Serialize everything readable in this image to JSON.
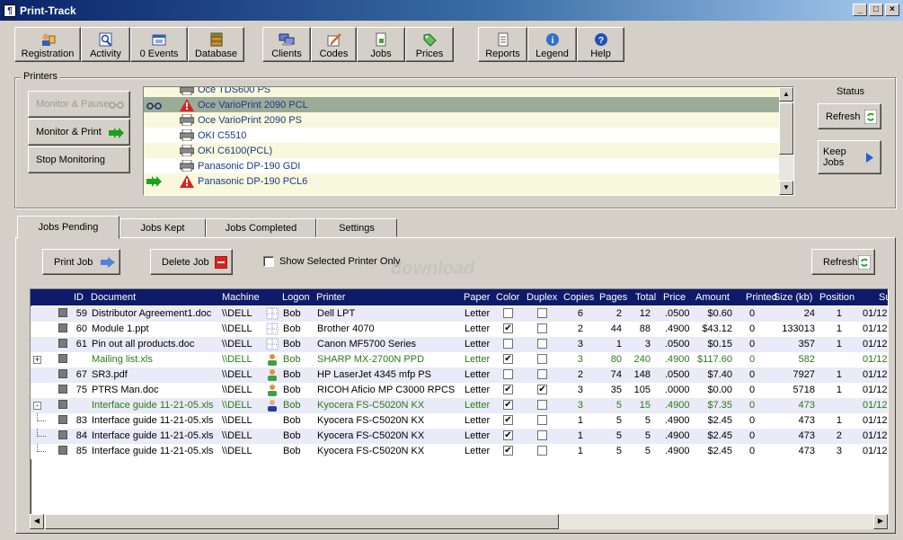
{
  "window": {
    "title": "Print-Track",
    "min": "_",
    "max": "□",
    "close": "×"
  },
  "toolbar": {
    "group1": [
      {
        "label": "Registration",
        "icon": "registration-icon"
      },
      {
        "label": "Activity",
        "icon": "activity-icon"
      },
      {
        "label": "0 Events",
        "icon": "events-icon"
      },
      {
        "label": "Database",
        "icon": "database-icon"
      }
    ],
    "group2": [
      {
        "label": "Clients",
        "icon": "clients-icon"
      },
      {
        "label": "Codes",
        "icon": "codes-icon"
      },
      {
        "label": "Jobs",
        "icon": "jobs-icon"
      },
      {
        "label": "Prices",
        "icon": "prices-icon"
      }
    ],
    "group3": [
      {
        "label": "Reports",
        "icon": "reports-icon"
      },
      {
        "label": "Legend",
        "icon": "legend-icon"
      },
      {
        "label": "Help",
        "icon": "help-icon"
      }
    ]
  },
  "printers_group": {
    "label": "Printers",
    "monitor_pause": "Monitor & Pause",
    "monitor_print": "Monitor & Print",
    "stop_monitoring": "Stop Monitoring",
    "status_label": "Status",
    "refresh": "Refresh",
    "keep_jobs": "Keep Jobs",
    "list": [
      {
        "name": "Oce TDS600 PS",
        "icon": "printer-icon",
        "mark": ""
      },
      {
        "name": "Oce VarioPrint 2090 PCL",
        "icon": "warning-icon",
        "mark": "glasses-icon",
        "selected": true
      },
      {
        "name": "Oce VarioPrint 2090 PS",
        "icon": "printer-icon",
        "mark": ""
      },
      {
        "name": "OKI C5510",
        "icon": "printer-icon",
        "mark": ""
      },
      {
        "name": "OKI C6100(PCL)",
        "icon": "printer-icon",
        "mark": ""
      },
      {
        "name": "Panasonic DP-190 GDI",
        "icon": "printer-icon",
        "mark": ""
      },
      {
        "name": "Panasonic DP-190 PCL6",
        "icon": "warning-icon",
        "mark": "green-arrow-icon"
      }
    ]
  },
  "tabs": [
    "Jobs Pending",
    "Jobs Kept",
    "Jobs Completed",
    "Settings"
  ],
  "jobs": {
    "print_job": "Print Job",
    "delete_job": "Delete Job",
    "show_selected": "Show Selected Printer Only",
    "refresh": "Refresh",
    "watermark": "download",
    "columns": [
      "ID",
      "Document",
      "Machine",
      "Logon",
      "Printer",
      "Paper",
      "Color",
      "Duplex",
      "Copies",
      "Pages",
      "Total",
      "Price",
      "Amount",
      "Printed",
      "Size (kb)",
      "Position",
      "Su"
    ],
    "rows": [
      {
        "exp": "",
        "id": "59",
        "doc": "Distributor Agreement1.doc",
        "machine": "\\\\DELL",
        "logon_icon": "grid",
        "logon": "Bob",
        "printer": "Dell LPT",
        "paper": "Letter",
        "color": false,
        "duplex": false,
        "copies": "6",
        "pages": "2",
        "total": "12",
        "price": ".0500",
        "amount": "$0.60",
        "printed": "0",
        "size": "24",
        "position": "1",
        "sub": "01/12",
        "green": false
      },
      {
        "exp": "",
        "id": "60",
        "doc": "Module 1.ppt",
        "machine": "\\\\DELL",
        "logon_icon": "grid",
        "logon": "Bob",
        "printer": "Brother 4070",
        "paper": "Letter",
        "color": true,
        "duplex": false,
        "copies": "2",
        "pages": "44",
        "total": "88",
        "price": ".4900",
        "amount": "$43.12",
        "printed": "0",
        "size": "133013",
        "position": "1",
        "sub": "01/12",
        "green": false
      },
      {
        "exp": "",
        "id": "61",
        "doc": "Pin out all products.doc",
        "machine": "\\\\DELL",
        "logon_icon": "grid",
        "logon": "Bob",
        "printer": "Canon MF5700 Series",
        "paper": "Letter",
        "color": false,
        "duplex": false,
        "copies": "3",
        "pages": "1",
        "total": "3",
        "price": ".0500",
        "amount": "$0.15",
        "printed": "0",
        "size": "357",
        "position": "1",
        "sub": "01/12",
        "green": false
      },
      {
        "exp": "+",
        "id": "",
        "doc": "Mailing list.xls",
        "machine": "\\\\DELL",
        "logon_icon": "user",
        "logon": "Bob",
        "printer": "SHARP MX-2700N PPD",
        "paper": "Letter",
        "color": true,
        "duplex": false,
        "copies": "3",
        "pages": "80",
        "total": "240",
        "price": ".4900",
        "amount": "$117.60",
        "printed": "0",
        "size": "582",
        "position": "",
        "sub": "01/12",
        "green": true
      },
      {
        "exp": "",
        "id": "67",
        "doc": "SR3.pdf",
        "machine": "\\\\DELL",
        "logon_icon": "user",
        "logon": "Bob",
        "printer": "HP LaserJet 4345 mfp PS",
        "paper": "Letter",
        "color": false,
        "duplex": false,
        "copies": "2",
        "pages": "74",
        "total": "148",
        "price": ".0500",
        "amount": "$7.40",
        "printed": "0",
        "size": "7927",
        "position": "1",
        "sub": "01/12",
        "green": false
      },
      {
        "exp": "",
        "id": "75",
        "doc": "PTRS Man.doc",
        "machine": "\\\\DELL",
        "logon_icon": "user",
        "logon": "Bob",
        "printer": "RICOH Aficio MP C3000 RPCS",
        "paper": "Letter",
        "color": true,
        "duplex": true,
        "copies": "3",
        "pages": "35",
        "total": "105",
        "price": ".0000",
        "amount": "$0.00",
        "printed": "0",
        "size": "5718",
        "position": "1",
        "sub": "01/12",
        "green": false
      },
      {
        "exp": "-",
        "id": "",
        "doc": "Interface guide 11-21-05.xls",
        "machine": "\\\\DELL",
        "logon_icon": "user2",
        "logon": "Bob",
        "printer": "Kyocera FS-C5020N KX",
        "paper": "Letter",
        "color": true,
        "duplex": false,
        "copies": "3",
        "pages": "5",
        "total": "15",
        "price": ".4900",
        "amount": "$7.35",
        "printed": "0",
        "size": "473",
        "position": "",
        "sub": "01/12",
        "green": true
      },
      {
        "exp": "|",
        "id": "83",
        "doc": "Interface guide 11-21-05.xls",
        "machine": "\\\\DELL",
        "logon_icon": "",
        "logon": "Bob",
        "printer": "Kyocera FS-C5020N KX",
        "paper": "Letter",
        "color": true,
        "duplex": false,
        "copies": "1",
        "pages": "5",
        "total": "5",
        "price": ".4900",
        "amount": "$2.45",
        "printed": "0",
        "size": "473",
        "position": "1",
        "sub": "01/12",
        "green": false
      },
      {
        "exp": "|",
        "id": "84",
        "doc": "Interface guide 11-21-05.xls",
        "machine": "\\\\DELL",
        "logon_icon": "",
        "logon": "Bob",
        "printer": "Kyocera FS-C5020N KX",
        "paper": "Letter",
        "color": true,
        "duplex": false,
        "copies": "1",
        "pages": "5",
        "total": "5",
        "price": ".4900",
        "amount": "$2.45",
        "printed": "0",
        "size": "473",
        "position": "2",
        "sub": "01/12",
        "green": false
      },
      {
        "exp": "|",
        "id": "85",
        "doc": "Interface guide 11-21-05.xls",
        "machine": "\\\\DELL",
        "logon_icon": "",
        "logon": "Bob",
        "printer": "Kyocera FS-C5020N KX",
        "paper": "Letter",
        "color": true,
        "duplex": false,
        "copies": "1",
        "pages": "5",
        "total": "5",
        "price": ".4900",
        "amount": "$2.45",
        "printed": "0",
        "size": "473",
        "position": "3",
        "sub": "01/12",
        "green": false
      }
    ]
  },
  "colors": {
    "title_start": "#0a246a",
    "grid_header": "#0e1a6a",
    "selected_printer": "#9bab98",
    "green_text": "#2a7a1a",
    "alt_row": "#eaeaf8",
    "printer_alt_row": "#f8f8dc"
  }
}
